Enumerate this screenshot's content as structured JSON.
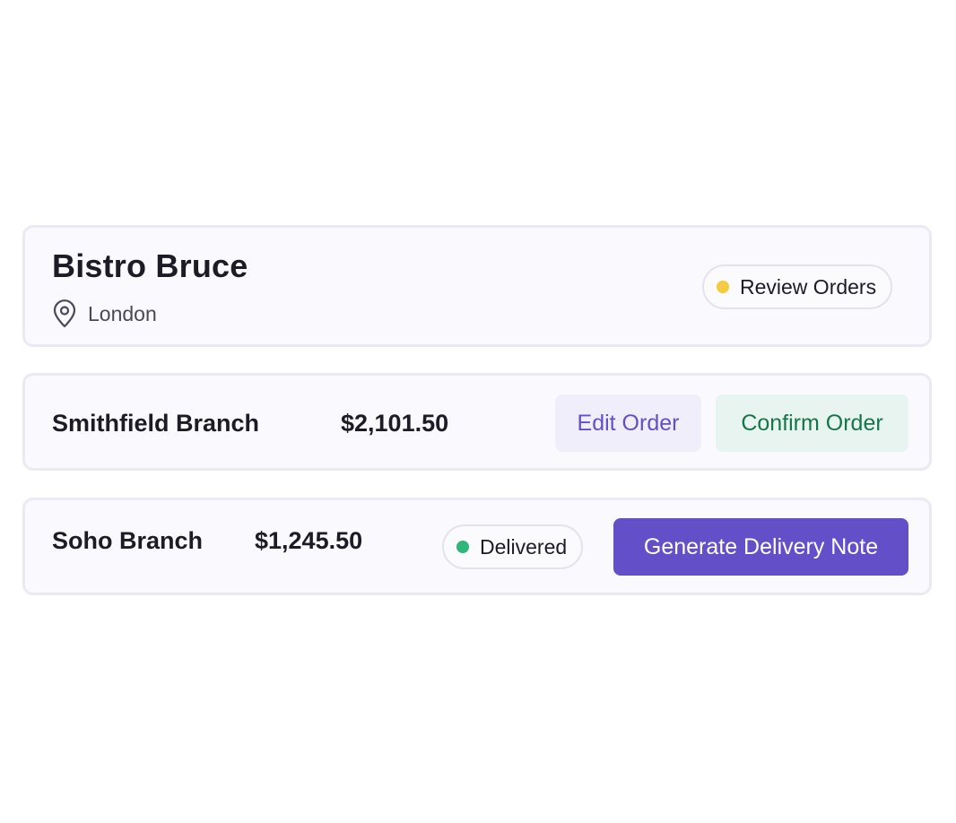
{
  "restaurant": {
    "name": "Bistro Bruce",
    "location": "London",
    "location_icon": "map-pin-icon",
    "status": {
      "label": "Review Orders",
      "dot_color": "#f6cb3f"
    }
  },
  "branches": [
    {
      "name": "Smithfield Branch",
      "amount": "$2,101.50",
      "actions": {
        "edit_label": "Edit Order",
        "confirm_label": "Confirm Order"
      }
    },
    {
      "name": "Soho Branch",
      "amount": "$1,245.50",
      "status": {
        "label": "Delivered",
        "dot_color": "#2fb67b"
      },
      "actions": {
        "generate_label": "Generate Delivery Note"
      }
    }
  ],
  "colors": {
    "accent": "#634fc7",
    "confirm_text": "#17754a",
    "card_border": "#ebe9f2"
  }
}
